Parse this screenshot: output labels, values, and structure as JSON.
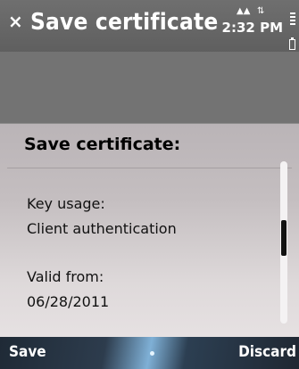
{
  "titlebar": {
    "title": "Save certificate",
    "time": "2:32 PM"
  },
  "dialog": {
    "title": "Save certificate:",
    "fields": [
      {
        "label": "Key usage:",
        "value": "Client authentication"
      },
      {
        "label": "Valid from:",
        "value": "06/28/2011"
      }
    ]
  },
  "softkeys": {
    "left": "Save",
    "right": "Discard"
  },
  "icons": {
    "close": "close-icon",
    "signal": "signal-strength-icon",
    "data": "packet-data-icon",
    "battery": "battery-icon"
  }
}
